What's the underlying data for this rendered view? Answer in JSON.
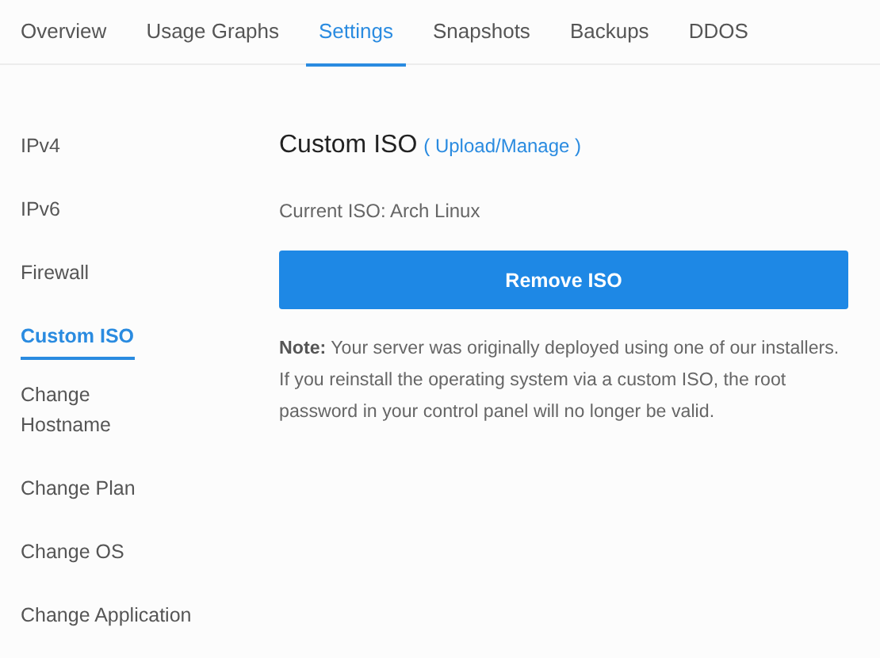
{
  "tabs": [
    {
      "label": "Overview",
      "selected": false
    },
    {
      "label": "Usage Graphs",
      "selected": false
    },
    {
      "label": "Settings",
      "selected": true
    },
    {
      "label": "Snapshots",
      "selected": false
    },
    {
      "label": "Backups",
      "selected": false
    },
    {
      "label": "DDOS",
      "selected": false
    }
  ],
  "sidebar": {
    "items": [
      {
        "label": "IPv4",
        "selected": false,
        "wrapped": false
      },
      {
        "label": "IPv6",
        "selected": false,
        "wrapped": false
      },
      {
        "label": "Firewall",
        "selected": false,
        "wrapped": false
      },
      {
        "label": "Custom ISO",
        "selected": true,
        "wrapped": false
      },
      {
        "label": "Change Hostname",
        "selected": false,
        "wrapped": true
      },
      {
        "label": "Change Plan",
        "selected": false,
        "wrapped": false
      },
      {
        "label": "Change OS",
        "selected": false,
        "wrapped": false
      },
      {
        "label": "Change Application",
        "selected": false,
        "wrapped": false
      }
    ]
  },
  "panel": {
    "title": "Custom ISO",
    "link": "( Upload/Manage )",
    "current_iso": "Current ISO: Arch Linux",
    "button": "Remove ISO",
    "note": "**Note:** Your server was originally deployed using one of our installers. If you reinstall the operating system via a custom ISO, the root password in your control panel will no longer be valid."
  }
}
